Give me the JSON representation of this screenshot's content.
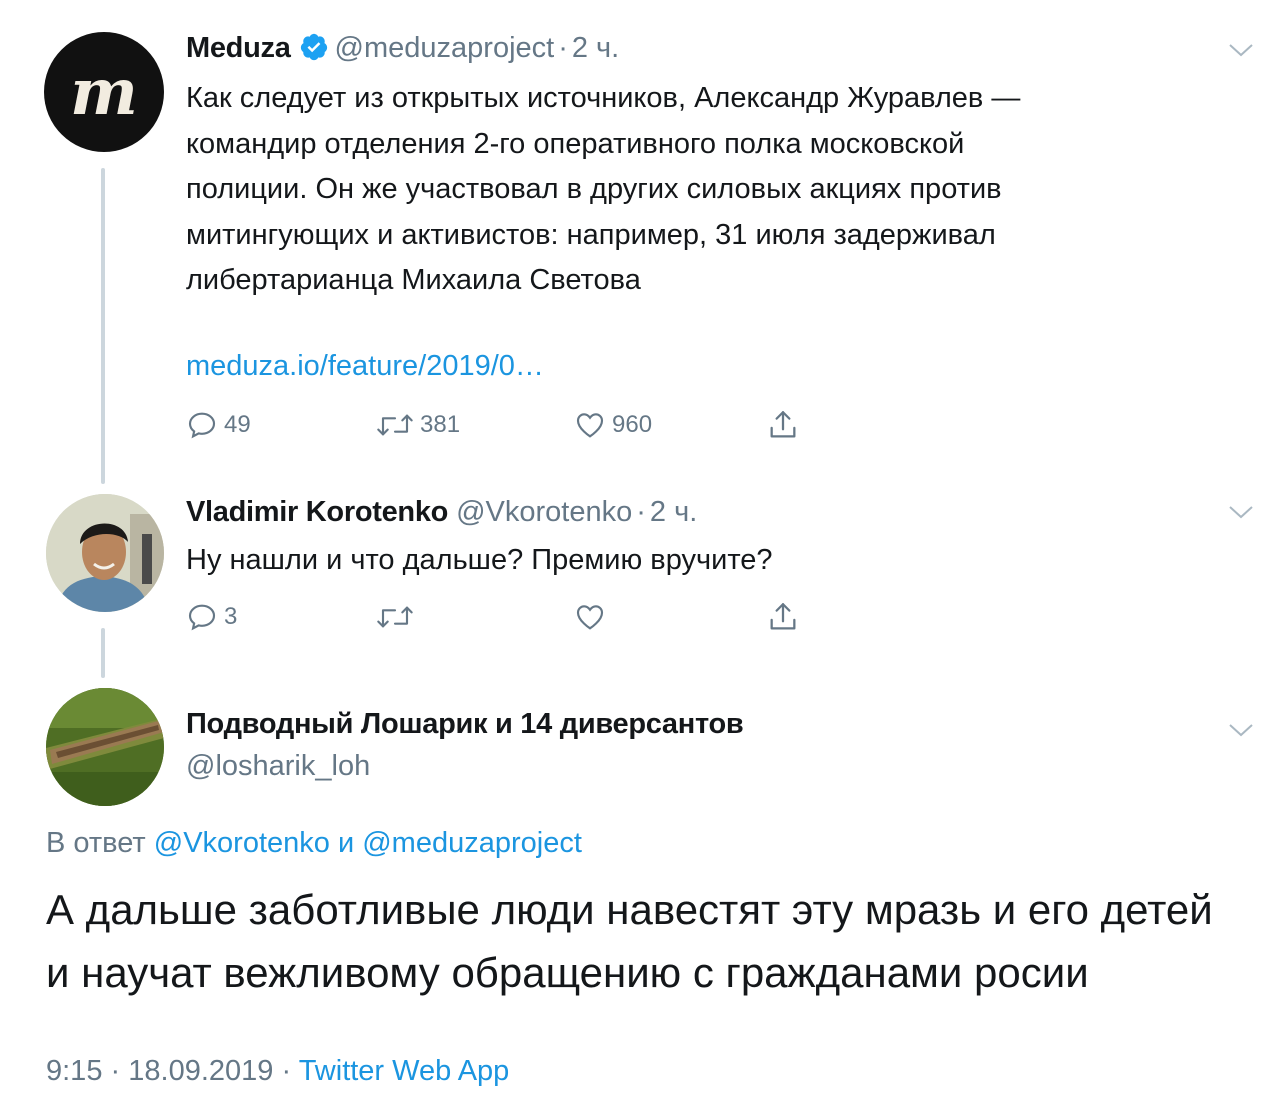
{
  "tweets": [
    {
      "name": "Meduza",
      "handle": "@meduzaproject",
      "time": "2 ч.",
      "verified": true,
      "avatar": "meduza-logo-avatar",
      "text_lines": [
        "Как следует из открытых источников, Александр Журавлев —",
        "командир отделения 2-го оперативного полка московской",
        "полиции. Он же участвовал в других силовых акциях против",
        "митингующих и активистов: например, 31 июля задерживал",
        "либертарианца Михаила Светова"
      ],
      "link": "meduza.io/feature/2019/0…",
      "actions": {
        "replies": "49",
        "retweets": "381",
        "likes": "960"
      }
    },
    {
      "name": "Vladimir Korotenko",
      "handle": "@Vkorotenko",
      "time": "2 ч.",
      "avatar": "user-photo-avatar",
      "text": "Ну нашли и что дальше? Премию вручите?",
      "actions": {
        "replies": "3",
        "retweets": "",
        "likes": ""
      }
    }
  ],
  "focused_tweet": {
    "name": "Подводный Лошарик и 14 диверсантов",
    "handle": "@losharik_loh",
    "avatar": "grass-log-avatar",
    "reply_prefix": "В ответ",
    "reply_mention_1": "@Vkorotenko",
    "reply_conjunction": "и",
    "reply_mention_2": "@meduzaproject",
    "text_lines": [
      "А дальше заботливые люди навестят эту мразь и его детей",
      "и научат вежливому обращению с гражданами росии"
    ],
    "time": "9:15",
    "date": "18.09.2019",
    "source": "Twitter Web App"
  },
  "separator": "·",
  "colors": {
    "text": "#14171a",
    "secondary": "#657786",
    "link": "#1b95e0",
    "verified": "#1da1f2",
    "thread_line": "#ccd6dd"
  }
}
